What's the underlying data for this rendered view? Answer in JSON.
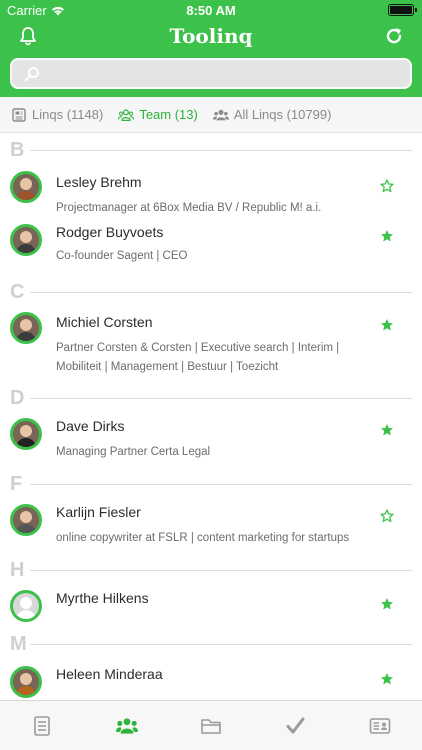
{
  "status": {
    "carrier": "Carrier",
    "time": "8:50 AM"
  },
  "nav": {
    "title": "Toolinq"
  },
  "search": {
    "placeholder": ""
  },
  "filters": [
    {
      "label": "Linqs (1148)",
      "active": false,
      "icon": "linqs-icon"
    },
    {
      "label": "Team (13)",
      "active": true,
      "icon": "team-icon"
    },
    {
      "label": "All Linqs (10799)",
      "active": false,
      "icon": "all-linqs-icon"
    }
  ],
  "sections": [
    {
      "letter": "B",
      "contacts": [
        {
          "name": "Lesley Brehm",
          "subtitle": [
            "Projectmanager at 6Box Media BV / Republic M! a.i."
          ],
          "starred": false,
          "avatar": "photo"
        },
        {
          "name": "Rodger Buyvoets",
          "subtitle": [
            "Co-founder Sagent | CEO"
          ],
          "starred": true,
          "avatar": "photo"
        }
      ]
    },
    {
      "letter": "C",
      "contacts": [
        {
          "name": "Michiel Corsten",
          "subtitle": [
            "Partner Corsten & Corsten | Executive search | Interim |",
            "Mobiliteit | Management | Bestuur | Toezicht"
          ],
          "starred": true,
          "avatar": "photo"
        }
      ]
    },
    {
      "letter": "D",
      "contacts": [
        {
          "name": "Dave Dirks",
          "subtitle": [
            "Managing Partner Certa Legal"
          ],
          "starred": true,
          "avatar": "photo"
        }
      ]
    },
    {
      "letter": "F",
      "contacts": [
        {
          "name": "Karlijn Fiesler",
          "subtitle": [
            "online copywriter at FSLR | content marketing for startups"
          ],
          "starred": false,
          "avatar": "photo"
        }
      ]
    },
    {
      "letter": "H",
      "contacts": [
        {
          "name": "Myrthe Hilkens",
          "subtitle": [],
          "starred": true,
          "avatar": "placeholder"
        }
      ]
    },
    {
      "letter": "M",
      "contacts": [
        {
          "name": "Heleen Minderaa",
          "subtitle": [],
          "starred": true,
          "avatar": "photo"
        }
      ]
    }
  ],
  "tabbar": [
    "linqs-list-icon",
    "team-icon",
    "folder-icon",
    "checkmark-icon",
    "contact-card-icon"
  ],
  "colors": {
    "accent": "#3cc24a",
    "active_text": "#2fb33d"
  }
}
